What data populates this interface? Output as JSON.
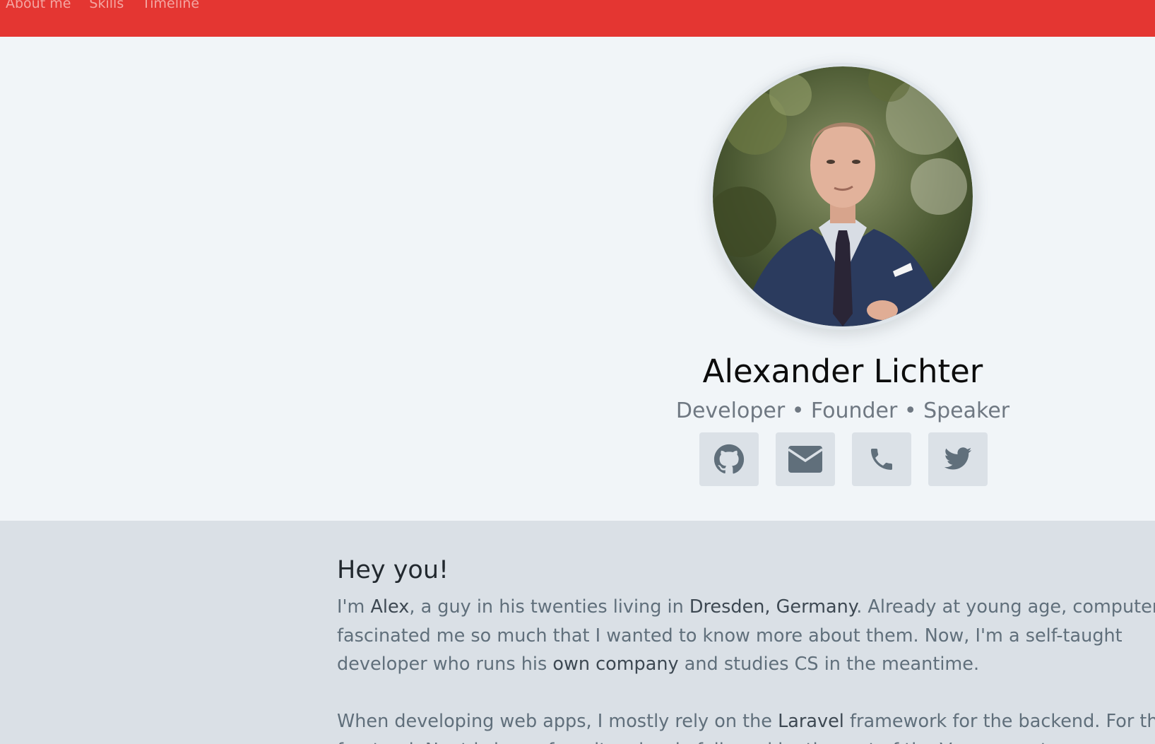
{
  "nav": {
    "items": [
      {
        "label": "About me"
      },
      {
        "label": "Skills"
      },
      {
        "label": "Timeline"
      }
    ]
  },
  "hero": {
    "name": "Alexander Lichter",
    "tagline": "Developer • Founder • Speaker",
    "socials": [
      {
        "icon": "github-icon"
      },
      {
        "icon": "envelope-icon"
      },
      {
        "icon": "phone-icon"
      },
      {
        "icon": "twitter-icon"
      }
    ]
  },
  "about": {
    "title": "Hey you!",
    "p1": {
      "s1": "I'm ",
      "name": "Alex",
      "s2": ", a guy in his twenties living in ",
      "place": "Dresden, Germany",
      "s3": ". Already at young age, computers fascinated me so much that I wanted to know more about them. Now, I'm a self-taught developer who runs his ",
      "company": "own company",
      "s4": " and studies CS in the meantime."
    },
    "p2": {
      "s1": "When developing web apps, I mostly rely on the ",
      "framework": "Laravel",
      "s2": " framework for the backend. For the frontend, Nuxt.js is my favorite, closely followed by the rest of the Vue ecosystem."
    }
  },
  "colors": {
    "navbar": "#e43632",
    "hero_bg": "#f1f5f8",
    "about_bg": "#dae0e6",
    "social_btn": "#dbe1e7",
    "icon": "#606f7b"
  }
}
